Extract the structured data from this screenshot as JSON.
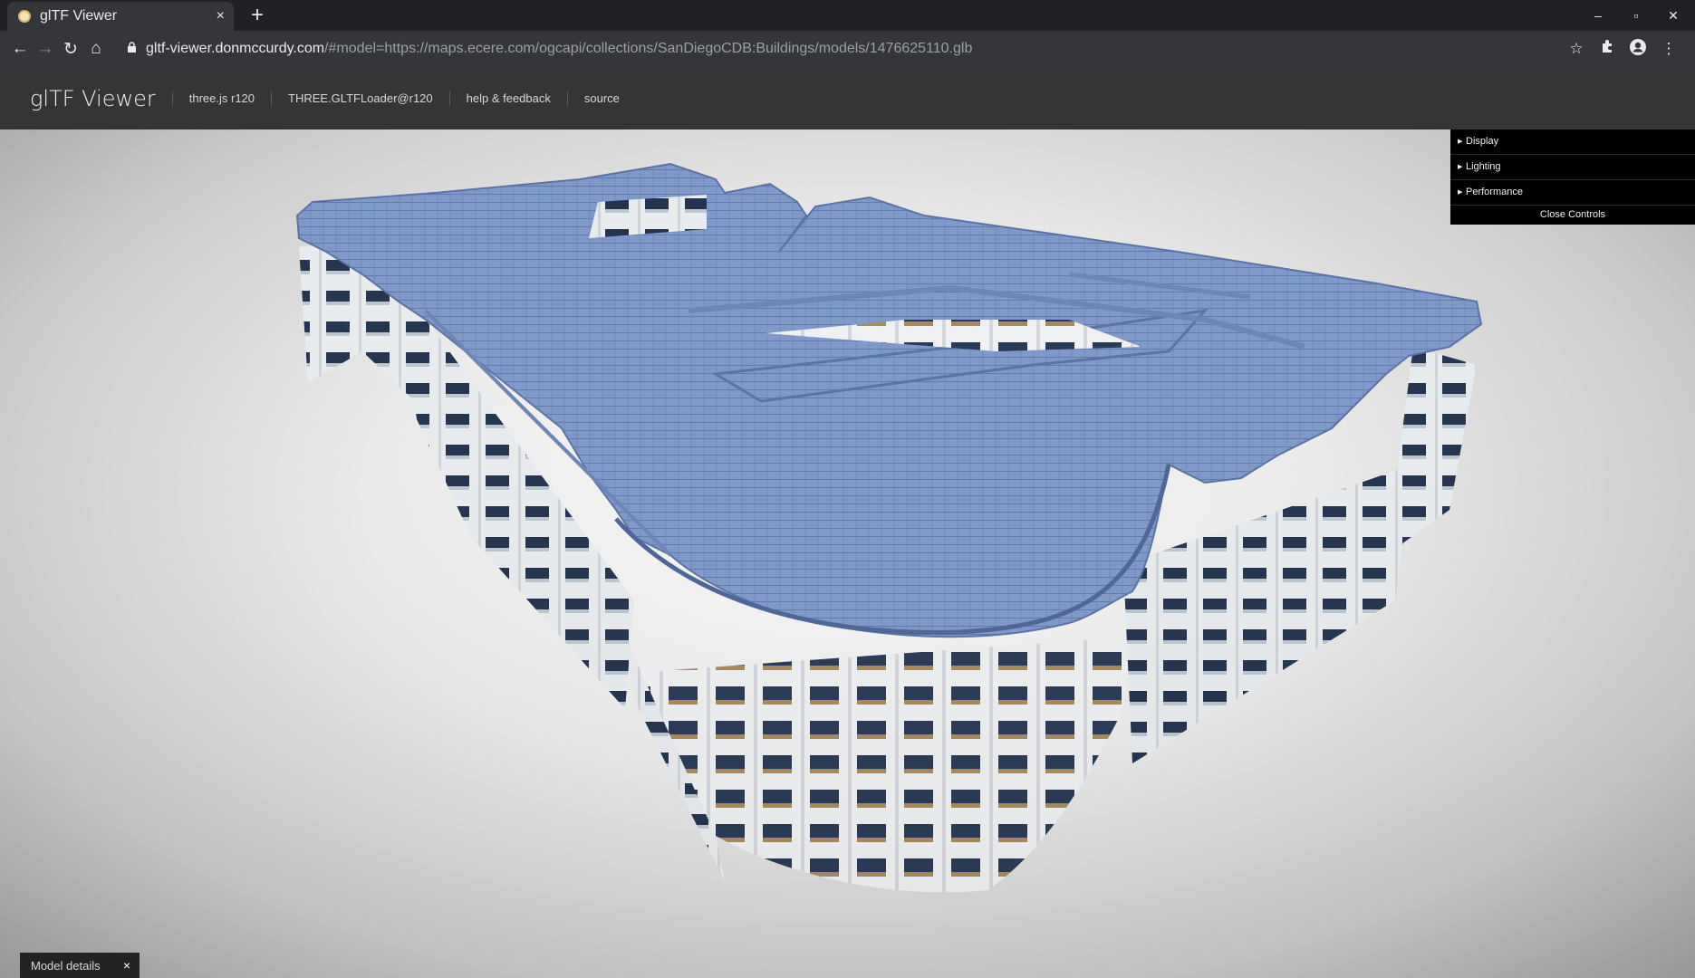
{
  "browser": {
    "tab_title": "glTF Viewer",
    "tab_close": "×",
    "new_tab": "+",
    "window_controls": {
      "minimize": "–",
      "maximize": "▫",
      "close": "✕"
    },
    "nav": {
      "back": "←",
      "forward": "→",
      "reload": "↻",
      "home": "⌂"
    },
    "url_host": "gltf-viewer.donmccurdy.com",
    "url_rest": "/#model=https://maps.ecere.com/ogcapi/collections/SanDiegoCDB:Buildings/models/1476625110.glb",
    "toolbar_icons": {
      "bookmark": "☆",
      "extensions": "✦",
      "profile": "●",
      "menu": "⋮"
    }
  },
  "app": {
    "brand": "glTF Viewer",
    "links": [
      "three.js r120",
      "THREE.GLTFLoader@r120",
      "help & feedback",
      "source"
    ]
  },
  "controls": {
    "folders": [
      "Display",
      "Lighting",
      "Performance"
    ],
    "close_label": "Close Controls"
  },
  "model_details": {
    "label": "Model details",
    "close": "×"
  },
  "colors": {
    "roof": "#7f99c9",
    "wall": "#e9ecef",
    "window": "#24344f",
    "panel_bg": "#000000",
    "header_bg": "#353535"
  },
  "icons": {
    "favicon": "gltf-favicon-icon",
    "lock": "lock-icon",
    "star": "star-icon",
    "puzzle": "extensions-icon",
    "account": "account-icon",
    "kebab": "menu-icon"
  }
}
